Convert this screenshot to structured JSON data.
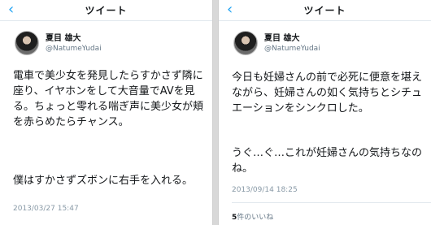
{
  "left": {
    "nav_title": "ツイート",
    "back_glyph": "‹",
    "display_name": "夏目 雄大",
    "handle": "@NatumeYudai",
    "paragraph_1": "電車で美少女を発見したらすかさず隣に座り、イヤホンをして大音量でAVを見る。ちょっと零れる喘ぎ声に美少女が頬を赤らめたらチャンス。",
    "paragraph_2": "僕はすかさずズボンに右手を入れる。",
    "timestamp": "2013/03/27 15:47"
  },
  "right": {
    "nav_title": "ツイート",
    "back_glyph": "‹",
    "display_name": "夏目 雄大",
    "handle": "@NatumeYudai",
    "paragraph_1": "今日も妊婦さんの前で必死に便意を堪えながら、妊婦さんの如く気持ちとシチュエーションをシンクロした。",
    "paragraph_2": "うぐ…ぐ…これが妊婦さんの気持ちなのね。",
    "timestamp": "2013/09/14 18:25",
    "likes_count": "5",
    "likes_label": "件のいいね"
  },
  "colors": {
    "accent": "#1da1f2",
    "muted": "#657786",
    "divider": "#e1e8ed"
  },
  "icons": {
    "back": "back-chevron-icon",
    "avatar": "avatar"
  }
}
